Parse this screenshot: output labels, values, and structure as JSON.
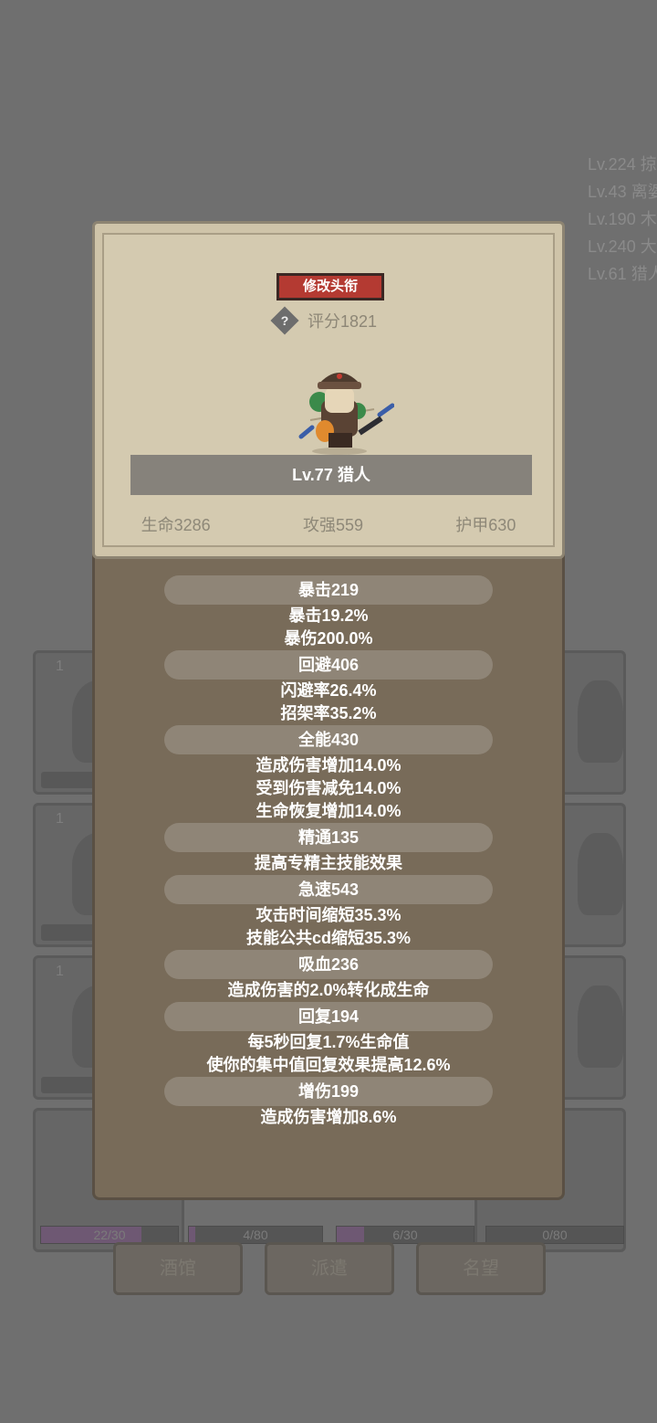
{
  "background": {
    "level_list": [
      "Lv.224 掠",
      "Lv.43 离婆",
      "Lv.190 木",
      "Lv.240 大",
      "Lv.61 猎人"
    ],
    "cards": [
      {
        "level": "1"
      },
      {
        "level": "1"
      },
      {
        "level": "1"
      }
    ],
    "progress": [
      {
        "text": "22/30",
        "fill": 0.73
      },
      {
        "text": "4/80",
        "fill": 0.05
      },
      {
        "text": "6/30",
        "fill": 0.2
      },
      {
        "text": "0/80",
        "fill": 0
      }
    ],
    "tabs": [
      "酒馆",
      "派遣",
      "名望"
    ]
  },
  "modal": {
    "title_button": "修改头衔",
    "help_icon": "?",
    "score": "评分1821",
    "hero_name": "Lv.77 猎人",
    "stats": [
      "生命3286",
      "攻强559",
      "护甲630"
    ],
    "attributes": [
      {
        "header": "暴击219",
        "lines": [
          "暴击19.2%",
          "暴伤200.0%"
        ]
      },
      {
        "header": "回避406",
        "lines": [
          "闪避率26.4%",
          "招架率35.2%"
        ]
      },
      {
        "header": "全能430",
        "lines": [
          "造成伤害增加14.0%",
          "受到伤害减免14.0%",
          "生命恢复增加14.0%"
        ]
      },
      {
        "header": "精通135",
        "lines": [
          "提高专精主技能效果"
        ]
      },
      {
        "header": "急速543",
        "lines": [
          "攻击时间缩短35.3%",
          "技能公共cd缩短35.3%"
        ]
      },
      {
        "header": "吸血236",
        "lines": [
          "造成伤害的2.0%转化成生命"
        ]
      },
      {
        "header": "回复194",
        "lines": [
          "每5秒回复1.7%生命值",
          "使你的集中值回复效果提高12.6%"
        ]
      },
      {
        "header": "增伤199",
        "lines": [
          "造成伤害增加8.6%"
        ]
      }
    ]
  }
}
